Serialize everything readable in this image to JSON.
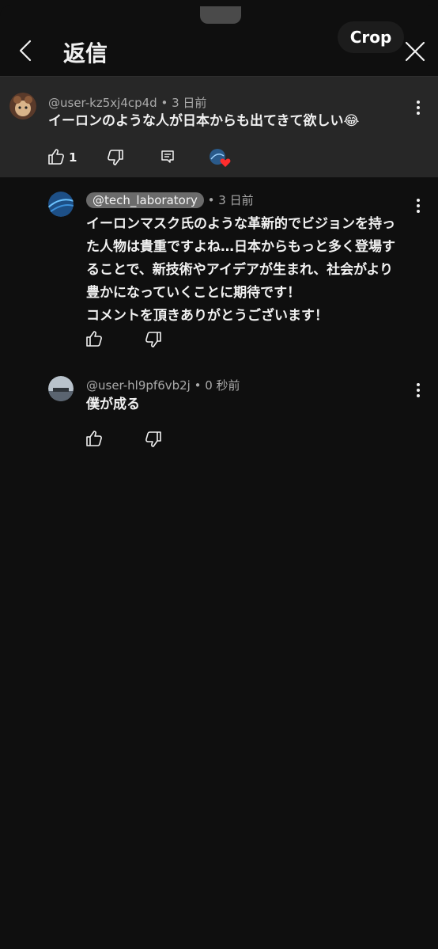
{
  "header": {
    "title": "返信",
    "crop_label": "Crop"
  },
  "parent_comment": {
    "handle": "@user-kz5xj4cp4d",
    "time": "• 3 日前",
    "text": "イーロンのような人が日本からも出てきて欲しい😂",
    "like_count": "1"
  },
  "replies": [
    {
      "handle": "@tech_laboratory",
      "time": "• 3 日前",
      "lines": [
        "イーロンマスク氏のような革新的でビジョンを持っ",
        "た人物は貴重ですよね…日本からもっと多く登場す",
        "ることで、新技術やアイデアが生まれ、社会がより",
        "豊かになっていくことに期待です！",
        "コメントを頂きありがとうございます！"
      ]
    },
    {
      "handle": "@user-hl9pf6vb2j",
      "time": "• 0 秒前",
      "lines": [
        "僕が成る"
      ]
    }
  ],
  "icons": {
    "back": "chevron-left-icon",
    "close": "close-icon",
    "like": "thumbs-up-icon",
    "dislike": "thumbs-down-icon",
    "reply": "comment-icon",
    "more": "more-vertical-icon",
    "creator_heart": "creator-heart-icon"
  },
  "colors": {
    "background": "#0f0f0f",
    "parent_highlight": "#272727",
    "heart": "#ff2d2d"
  }
}
